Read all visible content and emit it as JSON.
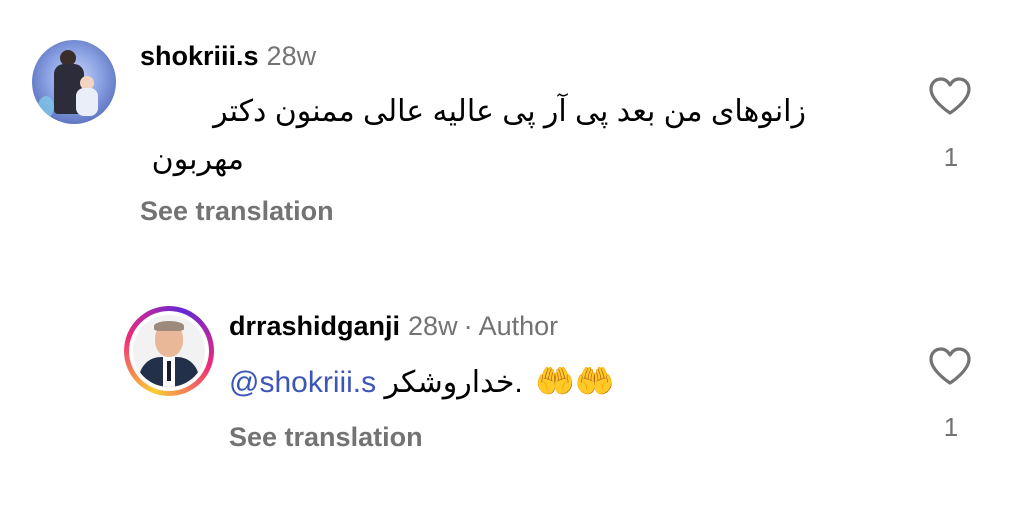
{
  "comments": [
    {
      "username": "shokriii.s",
      "time": "28w",
      "text_line1": "زانوهای من بعد پی آر پی عالیه عالی ممنون دکتر",
      "text_line2": "مهربون",
      "see_translation": "See translation",
      "likes": "1",
      "avatar_icon": "profile-photo"
    },
    {
      "username": "drrashidganji",
      "time": "28w",
      "separator": "·",
      "author_label": "Author",
      "mention": "@shokriii.s",
      "text_rtl": "خداروشکر",
      "text_suffix": ".",
      "emoji": "🤲🤲",
      "see_translation": "See translation",
      "likes": "1",
      "avatar_icon": "profile-photo-story-ring"
    }
  ],
  "icons": {
    "like": "heart-outline-icon"
  },
  "colors": {
    "secondary_text": "#737373",
    "mention": "#3c56b8",
    "story_ring_start": "#f9ce34",
    "story_ring_mid": "#ee2a7b",
    "story_ring_end": "#6228d7"
  }
}
